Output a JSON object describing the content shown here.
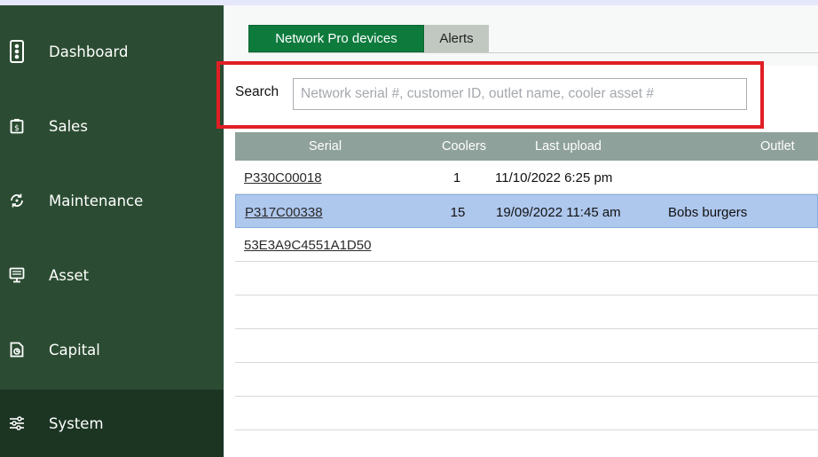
{
  "sidebar": {
    "items": [
      {
        "label": "Dashboard",
        "icon": "traffic-light-icon"
      },
      {
        "label": "Sales",
        "icon": "price-tag-icon"
      },
      {
        "label": "Maintenance",
        "icon": "maintenance-cycle-icon"
      },
      {
        "label": "Asset",
        "icon": "cooler-asset-icon"
      },
      {
        "label": "Capital",
        "icon": "document-capital-icon"
      },
      {
        "label": "System",
        "icon": "sliders-icon",
        "active": true
      }
    ]
  },
  "tabs": [
    {
      "label": "Network Pro devices",
      "active": true
    },
    {
      "label": "Alerts",
      "active": false
    }
  ],
  "search": {
    "label": "Search",
    "placeholder": "Network serial #, customer ID, outlet name, cooler asset #",
    "value": ""
  },
  "table": {
    "columns": [
      "Serial",
      "Coolers",
      "Last upload",
      "Outlet"
    ],
    "rows": [
      {
        "serial": "P330C00018",
        "coolers": "1",
        "last_upload": "11/10/2022 6:25 pm",
        "outlet": ""
      },
      {
        "serial": "P317C00338",
        "coolers": "15",
        "last_upload": "19/09/2022 11:45 am",
        "outlet": "Bobs burgers",
        "selected": true
      },
      {
        "serial": "53E3A9C4551A1D50",
        "coolers": "",
        "last_upload": "",
        "outlet": ""
      }
    ]
  },
  "colors": {
    "sidebar_bg": "#2b4c32",
    "sidebar_active": "#1c3523",
    "tab_active": "#0e7b3d",
    "header_bg": "#8fa19b",
    "selected_row": "#aec7ed",
    "highlight": "#e01f25"
  }
}
